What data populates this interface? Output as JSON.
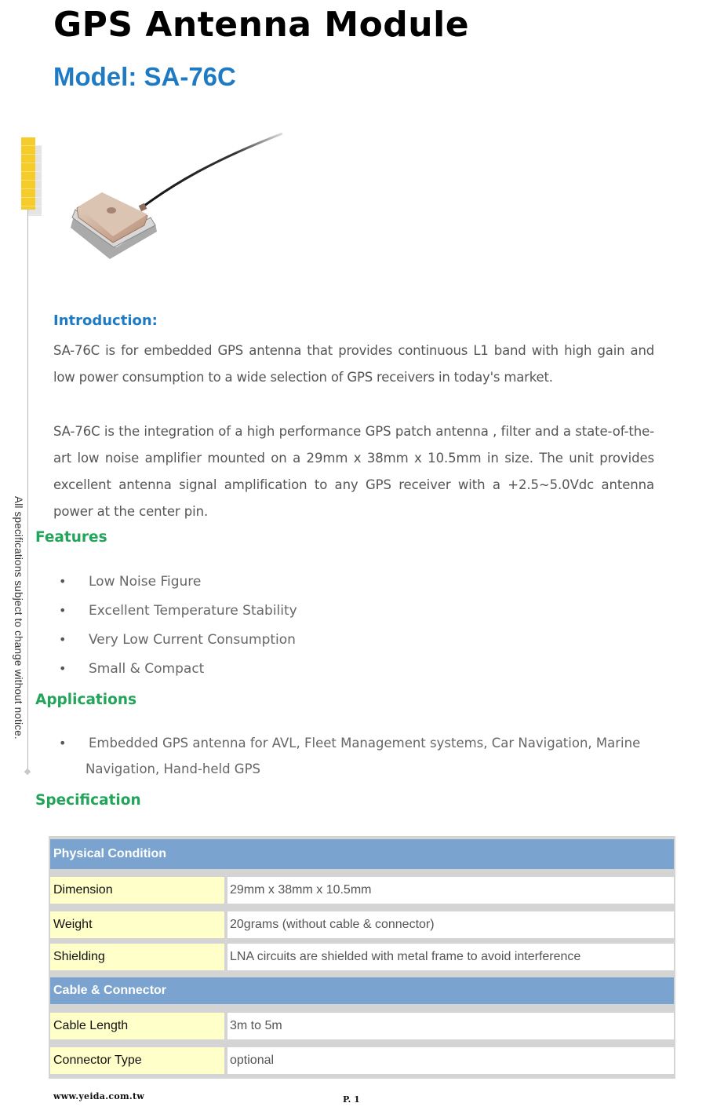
{
  "header": {
    "title": "GPS Antenna Module",
    "model": "Model: SA-76C"
  },
  "side_note": "All specifications subject to change without notice.",
  "product_image": {
    "alt": "SA-76C GPS patch antenna with cable"
  },
  "introduction": {
    "heading": "Introduction:",
    "paragraphs": [
      "SA-76C is for embedded GPS antenna that provides continuous L1 band with high gain and low power consumption to a wide selection of GPS receivers in today's market.",
      "SA-76C is the integration of a high performance GPS patch antenna , filter and a state-of-the-art low noise amplifier mounted on a 29mm x 38mm x 10.5mm in size. The unit provides excellent antenna signal amplification to any GPS receiver with a +2.5~5.0Vdc antenna power at the center pin."
    ]
  },
  "features": {
    "heading": "Features",
    "bullet": "•",
    "items": [
      "Low Noise Figure",
      "Excellent Temperature Stability",
      "Very Low Current Consumption",
      "Small & Compact"
    ]
  },
  "applications": {
    "heading": "Applications",
    "bullet": "•",
    "line1": "Embedded GPS antenna for AVL, Fleet Management systems, Car Navigation, Marine",
    "line2": "Navigation, Hand-held GPS"
  },
  "specification": {
    "heading": "Specification",
    "sections": [
      {
        "title": "Physical Condition",
        "rows": [
          {
            "label": "Dimension",
            "value": "29mm x 38mm x 10.5mm"
          },
          {
            "label": "Weight",
            "value": "20grams (without cable & connector)"
          },
          {
            "label": "Shielding",
            "value": "LNA circuits are shielded with metal frame to avoid interference"
          }
        ]
      },
      {
        "title": "Cable & Connector",
        "rows": [
          {
            "label": "Cable Length",
            "value": "3m to 5m"
          },
          {
            "label": "Connector Type",
            "value": "optional"
          }
        ]
      }
    ]
  },
  "footer": {
    "url": "www.yeida.com.tw",
    "page": "P. 1"
  },
  "colors": {
    "model_blue": "#1f7ac4",
    "heading_green": "#22a45a",
    "table_header": "#7aa4cf",
    "label_cell": "#ffffc9",
    "accent_yellow": "#f5cc2a"
  }
}
